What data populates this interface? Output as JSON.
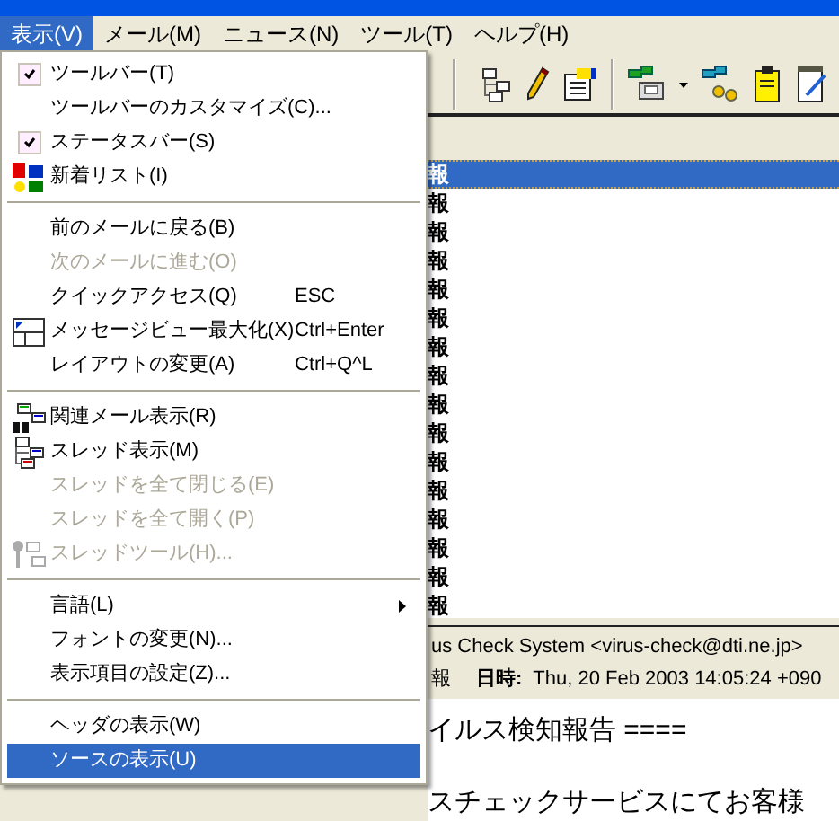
{
  "menubar": [
    {
      "label": "表示(V)",
      "selected": true
    },
    {
      "label": "メール(M)",
      "selected": false
    },
    {
      "label": "ニュース(N)",
      "selected": false
    },
    {
      "label": "ツール(T)",
      "selected": false
    },
    {
      "label": "ヘルプ(H)",
      "selected": false
    }
  ],
  "menu": [
    {
      "kind": "check",
      "label": "ツールバー(T)",
      "checked": true
    },
    {
      "kind": "plain",
      "label": "ツールバーのカスタマイズ(C)..."
    },
    {
      "kind": "check",
      "label": "ステータスバー(S)",
      "checked": true
    },
    {
      "kind": "new",
      "label": "新着リスト(I)"
    },
    {
      "kind": "separator"
    },
    {
      "kind": "plain",
      "label": "前のメールに戻る(B)",
      "disabled": false
    },
    {
      "kind": "plain",
      "label": "次のメールに進む(O)",
      "disabled": true
    },
    {
      "kind": "plain",
      "label": "クイックアクセス(Q)",
      "shortcut": "ESC"
    },
    {
      "kind": "maximize",
      "label": "メッセージビュー最大化(X)",
      "shortcut": "Ctrl+Enter"
    },
    {
      "kind": "plain",
      "label": "レイアウトの変更(A)",
      "shortcut": "Ctrl+Q^L"
    },
    {
      "kind": "separator"
    },
    {
      "kind": "related",
      "label": "関連メール表示(R)"
    },
    {
      "kind": "thread",
      "label": "スレッド表示(M)"
    },
    {
      "kind": "plain",
      "label": "スレッドを全て閉じる(E)",
      "disabled": true
    },
    {
      "kind": "plain",
      "label": "スレッドを全て開く(P)",
      "disabled": true
    },
    {
      "kind": "threadtool",
      "label": "スレッドツール(H)...",
      "disabled": true
    },
    {
      "kind": "separator"
    },
    {
      "kind": "submenu",
      "label": "言語(L)"
    },
    {
      "kind": "plain",
      "label": "フォントの変更(N)..."
    },
    {
      "kind": "plain",
      "label": "表示項目の設定(Z)..."
    },
    {
      "kind": "separator"
    },
    {
      "kind": "plain",
      "label": "ヘッダの表示(W)",
      "selected": false
    },
    {
      "kind": "plain",
      "label": "ソースの表示(U)",
      "selected": true
    }
  ],
  "message_list": [
    {
      "text": "報",
      "selected": true
    },
    {
      "text": "報",
      "selected": false
    },
    {
      "text": "報",
      "selected": false
    },
    {
      "text": "報",
      "selected": false
    },
    {
      "text": "報",
      "selected": false
    },
    {
      "text": "報",
      "selected": false
    },
    {
      "text": "報",
      "selected": false
    },
    {
      "text": "報",
      "selected": false
    },
    {
      "text": "報",
      "selected": false
    },
    {
      "text": "報",
      "selected": false
    },
    {
      "text": "報",
      "selected": false
    },
    {
      "text": "報",
      "selected": false
    },
    {
      "text": "報",
      "selected": false
    },
    {
      "text": "報",
      "selected": false
    },
    {
      "text": "報",
      "selected": false
    },
    {
      "text": "報",
      "selected": false
    }
  ],
  "preview_header": {
    "from": "us Check System <virus-check@dti.ne.jp>",
    "subject": "報",
    "date_label": "日時:",
    "date": "Thu, 20 Feb 2003 14:05:24 +090"
  },
  "preview_body": [
    "イルス検知報告  ====",
    "スチェックサービスにてお客様"
  ]
}
